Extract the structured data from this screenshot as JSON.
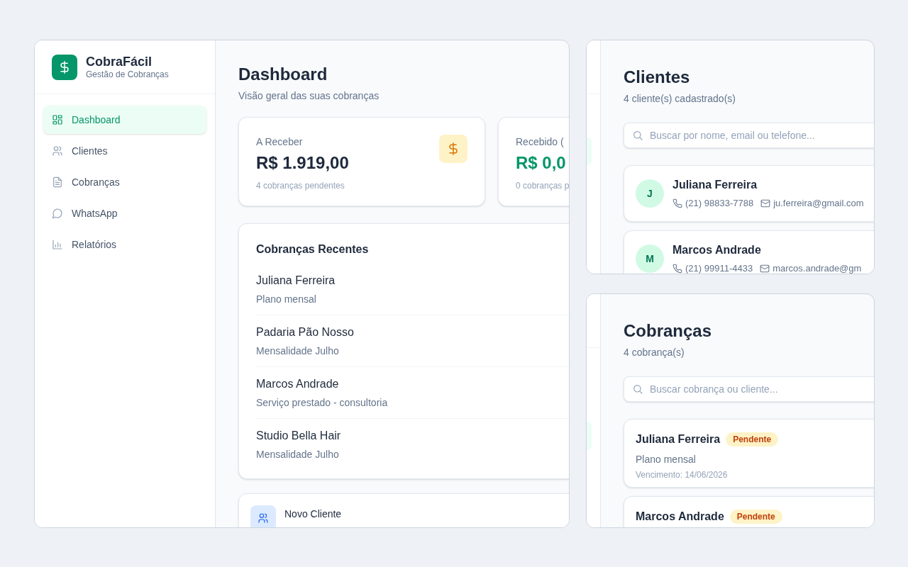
{
  "dashboard_window": {
    "app": {
      "name": "CobraFácil",
      "tagline": "Gestão de Cobranças"
    },
    "nav": [
      {
        "label": "Dashboard",
        "selected": true
      },
      {
        "label": "Clientes",
        "selected": false
      },
      {
        "label": "Cobranças",
        "selected": false
      },
      {
        "label": "WhatsApp",
        "selected": false
      },
      {
        "label": "Relatórios",
        "selected": false
      }
    ],
    "header": {
      "title": "Dashboard",
      "subtitle": "Visão geral das suas cobranças"
    },
    "stat_cards": [
      {
        "label": "A Receber",
        "value": "R$ 1.919,00",
        "note": "4 cobranças pendentes",
        "kind": "pending"
      },
      {
        "label": "Recebido (",
        "value": "R$ 0,0",
        "note": "0 cobranças p",
        "kind": "paid"
      }
    ],
    "recent": {
      "title": "Cobranças Recentes",
      "items": [
        {
          "name": "Juliana Ferreira",
          "description": "Plano mensal"
        },
        {
          "name": "Padaria Pão Nosso",
          "description": "Mensalidade Julho"
        },
        {
          "name": "Marcos Andrade",
          "description": "Serviço prestado - consultoria"
        },
        {
          "name": "Studio Bella Hair",
          "description": "Mensalidade Julho"
        }
      ]
    },
    "quick_actions": [
      {
        "label": "Novo Cliente"
      }
    ]
  },
  "clients_window": {
    "title": "Clientes",
    "subtitle": "4 cliente(s) cadastrado(s)",
    "search": {
      "placeholder": "Buscar por nome, email ou telefone..."
    },
    "clients": [
      {
        "initial": "J",
        "name": "Juliana Ferreira",
        "phone": "(21) 98833-7788",
        "email": "ju.ferreira@gmail.com"
      },
      {
        "initial": "M",
        "name": "Marcos Andrade",
        "phone": "(21) 99911-4433",
        "email": "marcos.andrade@gm"
      }
    ]
  },
  "charges_window": {
    "title": "Cobranças",
    "subtitle": "4 cobrança(s)",
    "search": {
      "placeholder": "Buscar cobrança ou cliente..."
    },
    "charges": [
      {
        "client": "Juliana Ferreira",
        "status": "Pendente",
        "kind": "pending",
        "description": "Plano mensal",
        "due": "Vencimento: 14/06/2026"
      },
      {
        "client": "Marcos Andrade",
        "status": "Pendente",
        "kind": "pending"
      }
    ]
  }
}
